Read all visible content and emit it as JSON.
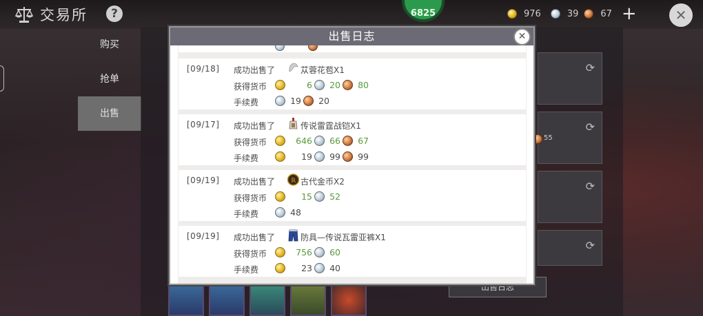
{
  "app": {
    "title": "交易所",
    "help_label": "?",
    "badge_text": "6825"
  },
  "currency": {
    "gold": "976",
    "silver": "39",
    "copper": "67",
    "plus_label": "+"
  },
  "nav": {
    "items": [
      {
        "label": "购买"
      },
      {
        "label": "抢单"
      },
      {
        "label": "出售"
      }
    ]
  },
  "background": {
    "card_copper_value": "55",
    "sell_log_button": "出售日志"
  },
  "modal": {
    "title": "出售日志",
    "entries": [
      {
        "date": "[09/18]",
        "sold_label": "成功出售了",
        "item_icon": "flower-icon",
        "item": "苁蓉花苞X1",
        "gain_label": "获得货币",
        "gain_gold": "6",
        "gain_silver": "20",
        "gain_copper": "80",
        "fee_label": "手续费",
        "fee_silver": "19",
        "fee_copper": "20"
      },
      {
        "date": "[09/17]",
        "sold_label": "成功出售了",
        "item_icon": "armor-icon",
        "item": "传说雷霆战铠X1",
        "gain_label": "获得货币",
        "gain_gold": "646",
        "gain_silver": "66",
        "gain_copper": "67",
        "fee_label": "手续费",
        "fee_gold": "19",
        "fee_silver": "99",
        "fee_copper": "99"
      },
      {
        "date": "[09/19]",
        "sold_label": "成功出售了",
        "item_icon": "ancient-coin-icon",
        "item": "古代金币X2",
        "gain_label": "获得货币",
        "gain_gold": "15",
        "gain_silver": "52",
        "fee_label": "手续费",
        "fee_silver": "48"
      },
      {
        "date": "[09/19]",
        "sold_label": "成功出售了",
        "item_icon": "pants-icon",
        "item": "防具—传说瓦雷亚裤X1",
        "gain_label": "获得货币",
        "gain_gold": "756",
        "gain_silver": "60",
        "fee_label": "手续费",
        "fee_gold": "23",
        "fee_silver": "40"
      }
    ]
  }
}
